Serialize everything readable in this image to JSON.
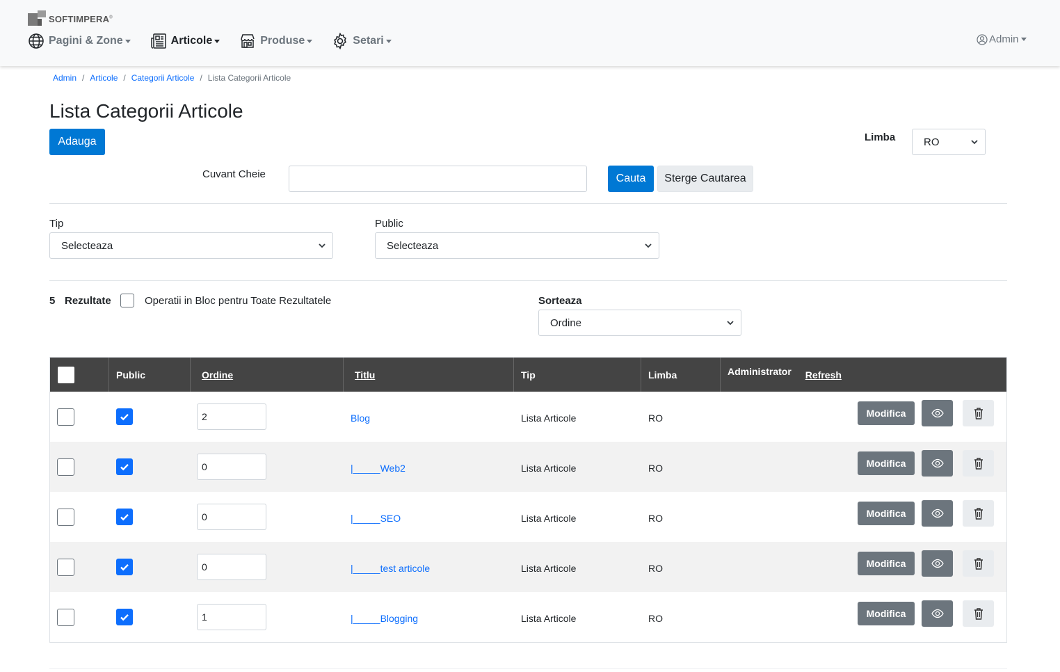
{
  "brand": {
    "logo_text": "SOFTIMPERA"
  },
  "nav": {
    "items": [
      {
        "label": "Pagini & Zone",
        "icon": "globe-icon",
        "active": false
      },
      {
        "label": "Articole",
        "icon": "newspaper-icon",
        "active": true
      },
      {
        "label": "Produse",
        "icon": "shop-icon",
        "active": false
      },
      {
        "label": "Setari",
        "icon": "gear-icon",
        "active": false
      }
    ],
    "user_label": "Admin"
  },
  "breadcrumb": [
    "Admin",
    "Articole",
    "Categorii Articole",
    "Lista Categorii Articole"
  ],
  "page": {
    "title": "Lista Categorii Articole",
    "add_button": "Adauga",
    "language_label": "Limba",
    "language_value": "RO",
    "keyword_label": "Cuvant Cheie",
    "keyword_value": "",
    "search_button": "Cauta",
    "clear_button": "Sterge Cautarea"
  },
  "filters": {
    "type_label": "Tip",
    "type_value": "Selecteaza",
    "public_label": "Public",
    "public_value": "Selecteaza",
    "results_count": "5",
    "results_label": "Rezultate",
    "bulk_label": "Operatii in Bloc pentru Toate Rezultatele",
    "sort_label": "Sorteaza",
    "sort_value": "Ordine"
  },
  "table": {
    "headers": {
      "public": "Public",
      "order": "Ordine",
      "title": "Titlu",
      "type": "Tip",
      "language": "Limba",
      "admin": "Administrator",
      "refresh": "Refresh"
    },
    "edit_label": "Modifica",
    "rows": [
      {
        "order": "2",
        "title": "Blog",
        "type": "Lista Articole",
        "language": "RO",
        "public": true
      },
      {
        "order": "0",
        "title": "|_____Web2",
        "type": "Lista Articole",
        "language": "RO",
        "public": true
      },
      {
        "order": "0",
        "title": "|_____SEO",
        "type": "Lista Articole",
        "language": "RO",
        "public": true
      },
      {
        "order": "0",
        "title": "|_____test articole",
        "type": "Lista Articole",
        "language": "RO",
        "public": true
      },
      {
        "order": "1",
        "title": "|_____Blogging",
        "type": "Lista Articole",
        "language": "RO",
        "public": true
      }
    ]
  },
  "colors": {
    "primary": "#0078d4",
    "link": "#0d6efd",
    "table_header": "#444444",
    "secondary_button": "#6c757d"
  }
}
